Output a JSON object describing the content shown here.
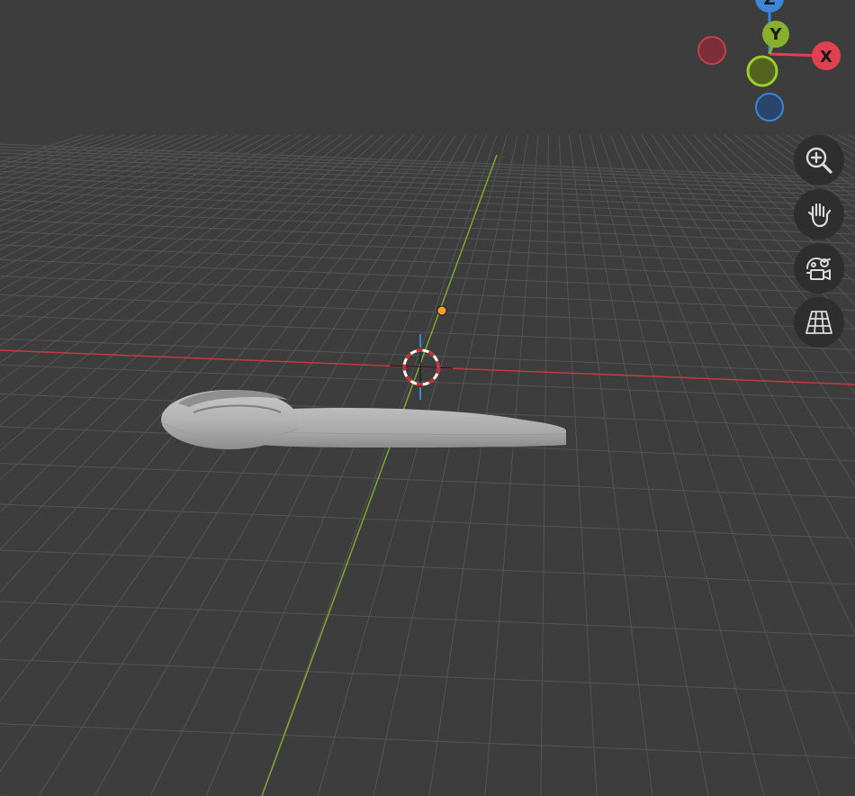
{
  "viewport": {
    "background": "#3d3d3d",
    "grid_color": "#555555",
    "x_axis_color": "#c9353f",
    "y_axis_color": "#7aa62a"
  },
  "gizmo": {
    "x_label": "X",
    "y_label": "Y",
    "z_label": "Z",
    "x_color": "#e0404f",
    "y_color": "#88b02e",
    "z_color": "#3b86d8"
  },
  "nav_buttons": [
    {
      "name": "zoom",
      "icon": "zoom-in-icon"
    },
    {
      "name": "pan",
      "icon": "hand-icon"
    },
    {
      "name": "camera-view",
      "icon": "camera-icon"
    },
    {
      "name": "perspective-toggle",
      "icon": "grid-icon"
    }
  ]
}
